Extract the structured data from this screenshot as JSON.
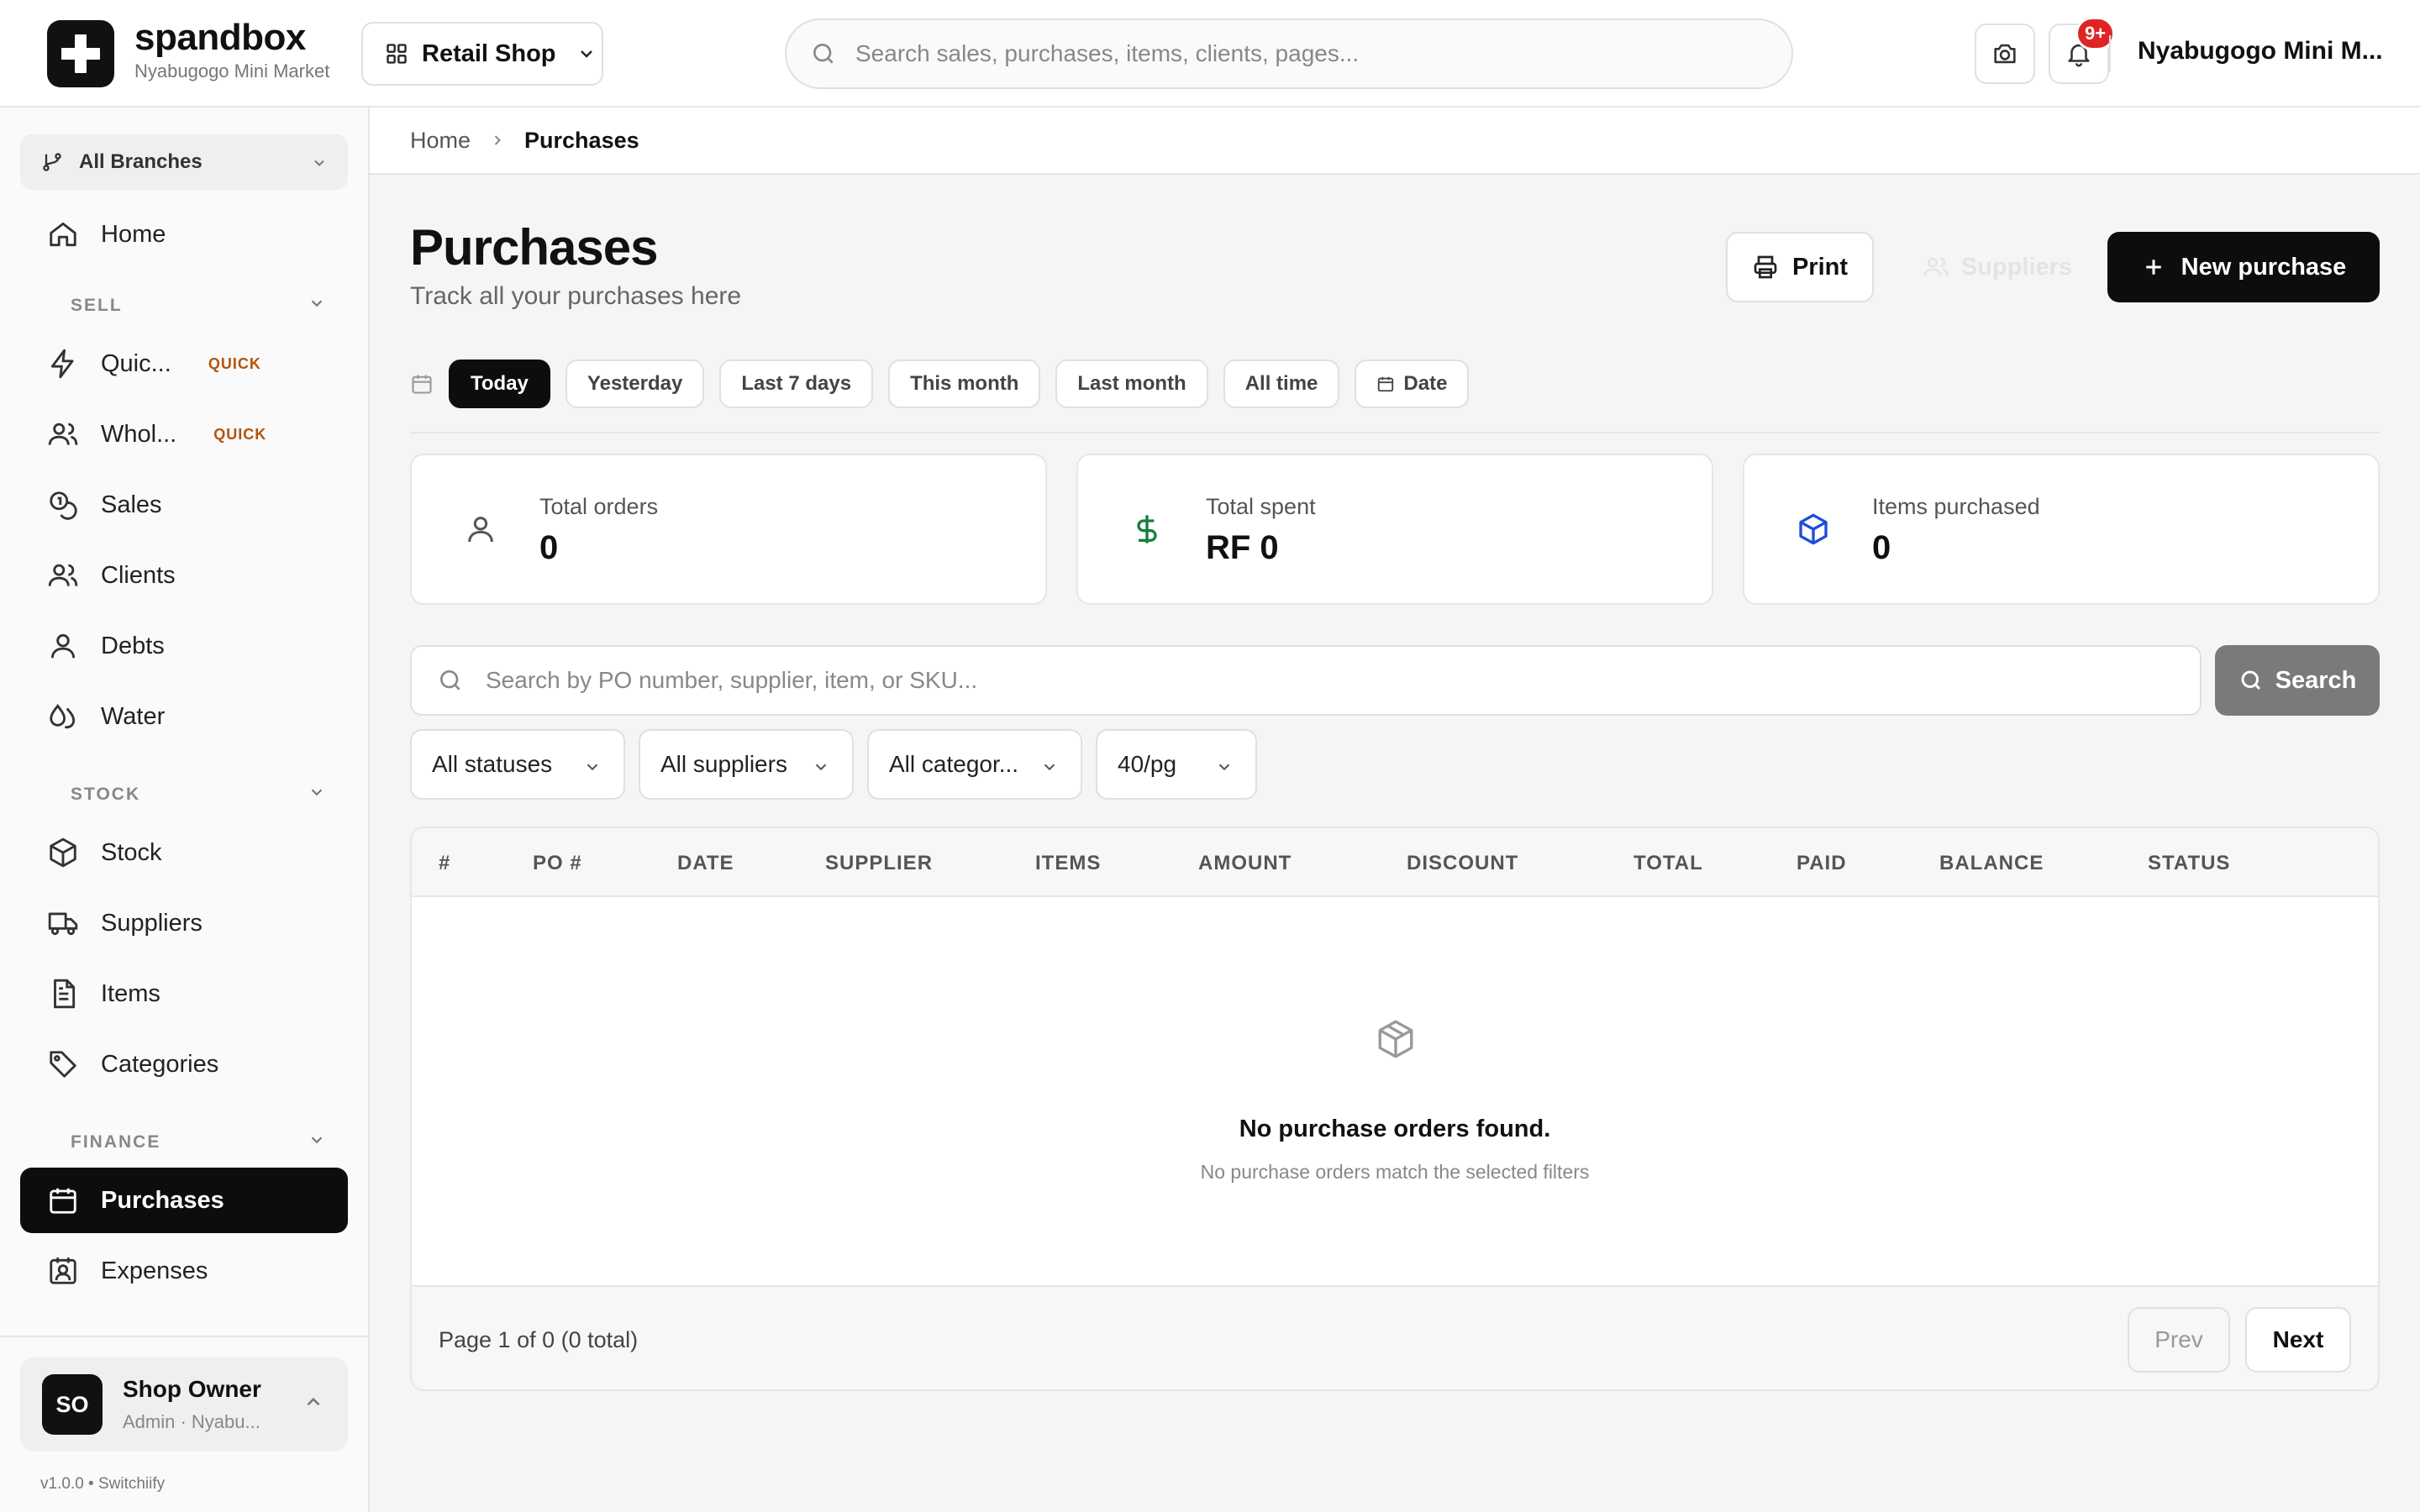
{
  "app": {
    "brand_name": "spandbox",
    "brand_sub": "Nyabugogo Mini Market",
    "shop_selector": "Retail Shop",
    "search_placeholder": "Search sales, purchases, items, clients, pages...",
    "notification_badge": "9+",
    "user_name": "Nyabugogo Mini M..."
  },
  "sidebar": {
    "branch": "All Branches",
    "home": "Home",
    "sections": {
      "sell": "SELL",
      "stock": "STOCK",
      "finance": "FINANCE"
    },
    "sell_items": [
      {
        "label": "Quic...",
        "tag": "QUICK"
      },
      {
        "label": "Whol...",
        "tag": "QUICK"
      },
      {
        "label": "Sales"
      },
      {
        "label": "Clients"
      },
      {
        "label": "Debts"
      },
      {
        "label": "Water"
      }
    ],
    "stock_items": [
      {
        "label": "Stock"
      },
      {
        "label": "Suppliers"
      },
      {
        "label": "Items"
      },
      {
        "label": "Categories"
      }
    ],
    "finance_items": [
      {
        "label": "Purchases"
      },
      {
        "label": "Expenses"
      }
    ],
    "user": {
      "initials": "SO",
      "name": "Shop Owner",
      "role": "Admin · Nyabu..."
    },
    "version": "v1.0.0 • Switchiify"
  },
  "breadcrumb": {
    "home": "Home",
    "current": "Purchases"
  },
  "page": {
    "title": "Purchases",
    "subtitle": "Track all your purchases here",
    "print_label": "Print",
    "suppliers_label": "Suppliers",
    "new_label": "New purchase"
  },
  "date_filters": [
    "Today",
    "Yesterday",
    "Last 7 days",
    "This month",
    "Last month",
    "All time",
    "Date"
  ],
  "stats": [
    {
      "label": "Total orders",
      "value": "0"
    },
    {
      "label": "Total spent",
      "value": "RF 0"
    },
    {
      "label": "Items purchased",
      "value": "0"
    }
  ],
  "search": {
    "placeholder": "Search by PO number, supplier, item, or SKU...",
    "button": "Search"
  },
  "filters": {
    "status": "All statuses",
    "supplier": "All suppliers",
    "category": "All categor...",
    "page_size": "40/pg"
  },
  "table": {
    "columns": [
      "#",
      "PO #",
      "DATE",
      "SUPPLIER",
      "ITEMS",
      "AMOUNT",
      "DISCOUNT",
      "TOTAL",
      "PAID",
      "BALANCE",
      "STATUS"
    ],
    "empty_title": "No purchase orders found.",
    "empty_sub": "No purchase orders match the selected filters",
    "page_info": "Page 1 of 0 (0 total)",
    "prev": "Prev",
    "next": "Next"
  },
  "colors": {
    "accent": "#0d0d0d",
    "badge": "#e02424",
    "quick_tag": "#b45309",
    "money_icon": "#15803d",
    "box_icon": "#1d4ed8"
  }
}
